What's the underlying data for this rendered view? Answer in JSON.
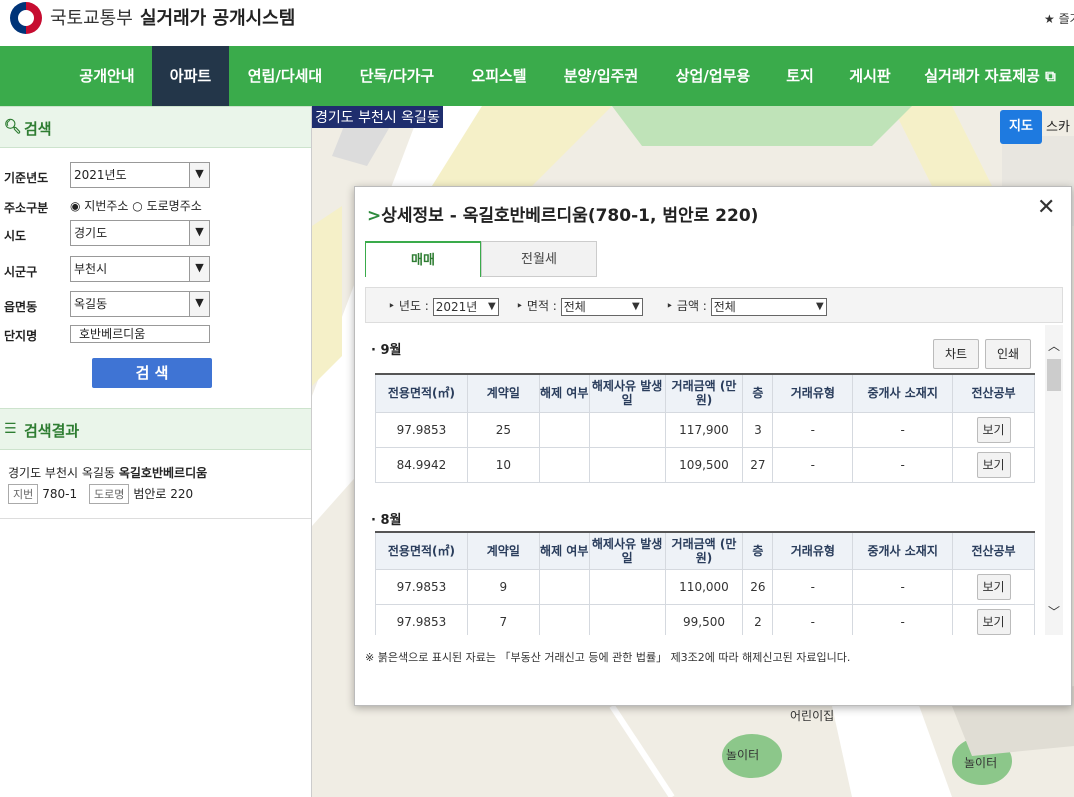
{
  "header": {
    "ministry": "국토교통부",
    "system_name": "실거래가 공개시스템",
    "favorite": "★ 즐겨"
  },
  "nav": {
    "items": [
      "공개안내",
      "아파트",
      "연립/다세대",
      "단독/다가구",
      "오피스텔",
      "분양/입주권",
      "상업/업무용",
      "토지",
      "게시판",
      "실거래가 자료제공 ⧉"
    ],
    "active_index": 1
  },
  "sidebar": {
    "search_title": "검색",
    "fields": {
      "year_label": "기준년도",
      "year_value": "2021년도",
      "addr_type_label": "주소구분",
      "addr_opt1": "지번주소",
      "addr_opt2": "도로명주소",
      "sido_label": "시도",
      "sido_value": "경기도",
      "sigungu_label": "시군구",
      "sigungu_value": "부천시",
      "dong_label": "읍면동",
      "dong_value": "옥길동",
      "complex_label": "단지명",
      "complex_value": "호반베르디움"
    },
    "search_button": "검 색",
    "result_title": "검색결과",
    "result": {
      "location": "경기도 부천시 옥길동",
      "name": "옥길호반베르디움",
      "jibun_tag": "지번",
      "jibun": "780-1",
      "road_tag": "도로명",
      "road": "범안로 220"
    }
  },
  "map": {
    "location_label": "경기도 부천시 옥길동",
    "map_tab": "지도",
    "sky_tab": "스카",
    "labels": {
      "kindergarten": "어린이집",
      "playground1": "놀이터",
      "playground2": "놀이터"
    }
  },
  "modal": {
    "title": "상세정보 - 옥길호반베르디움(780-1, 범안로 220)",
    "tabs": [
      "매매",
      "전월세"
    ],
    "filters": {
      "year_label": "년도 :",
      "year_value": "2021년",
      "area_label": "면적 :",
      "area_value": "전체",
      "price_label": "금액 :",
      "price_value": "전체"
    },
    "chart_button": "차트",
    "print_button": "인쇄",
    "columns": [
      "전용면적(㎡)",
      "계약일",
      "해제 여부",
      "해제사유 발생일",
      "거래금액 (만원)",
      "층",
      "거래유형",
      "중개사 소재지",
      "전산공부"
    ],
    "months": [
      {
        "label": "· 9월",
        "rows": [
          [
            "97.9853",
            "25",
            "",
            "",
            "117,900",
            "3",
            "-",
            "-",
            "보기"
          ],
          [
            "84.9942",
            "10",
            "",
            "",
            "109,500",
            "27",
            "-",
            "-",
            "보기"
          ]
        ]
      },
      {
        "label": "· 8월",
        "rows": [
          [
            "97.9853",
            "9",
            "",
            "",
            "110,000",
            "26",
            "-",
            "-",
            "보기"
          ],
          [
            "97.9853",
            "7",
            "",
            "",
            "99,500",
            "2",
            "-",
            "-",
            "보기"
          ]
        ]
      }
    ],
    "note": "※ 붉은색으로 표시된 자료는 「부동산 거래신고 등에 관한 법률」 제3조2에 따라 해제신고된 자료입니다."
  }
}
